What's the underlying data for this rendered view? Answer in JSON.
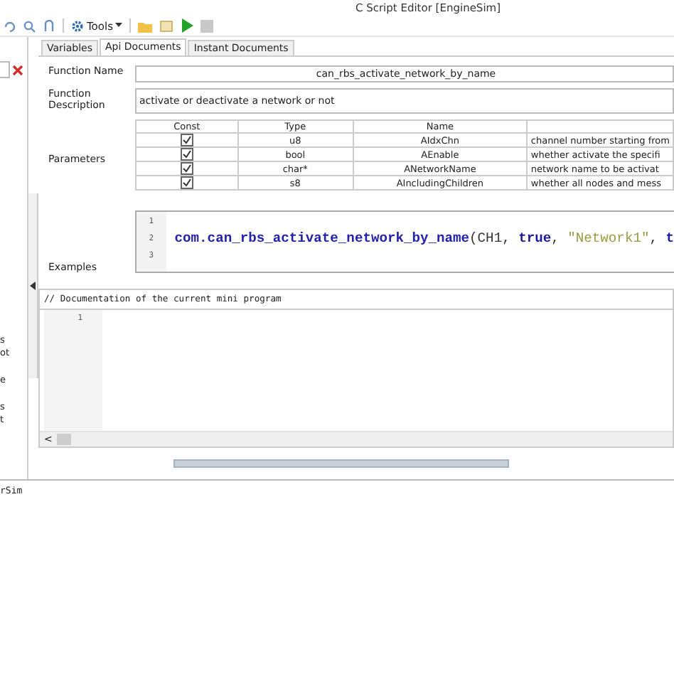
{
  "window": {
    "title": "C Script Editor [EngineSim]"
  },
  "toolbar": {
    "tools_label": "Tools"
  },
  "left_panel": {
    "fragments": [
      "s",
      "ot",
      "e",
      "s",
      "t"
    ]
  },
  "tabs": [
    {
      "label": "Variables",
      "selected": false
    },
    {
      "label": "Api Documents",
      "selected": true
    },
    {
      "label": "Instant Documents",
      "selected": false
    }
  ],
  "function_name": {
    "label": "Function Name",
    "value": "can_rbs_activate_network_by_name"
  },
  "function_description": {
    "label": "Function Description",
    "value": "activate or deactivate a network or not"
  },
  "parameters": {
    "label": "Parameters",
    "columns": [
      "Const",
      "Type",
      "Name"
    ],
    "rows": [
      {
        "const": true,
        "type": "u8",
        "name": "AIdxChn",
        "description": "channel number starting from"
      },
      {
        "const": true,
        "type": "bool",
        "name": "AEnable",
        "description": "whether activate the specifi"
      },
      {
        "const": true,
        "type": "char*",
        "name": "ANetworkName",
        "description": "network name to be activat"
      },
      {
        "const": true,
        "type": "s8",
        "name": "AIncludingChildren",
        "description": "whether all nodes and mess"
      }
    ]
  },
  "examples": {
    "label": "Examples",
    "line_numbers": [
      "1",
      "2",
      "3"
    ],
    "code_tokens": [
      {
        "kind": "func",
        "text": "com.can_rbs_activate_network_by_name"
      },
      {
        "kind": "plain",
        "text": "(CH1, "
      },
      {
        "kind": "keyword",
        "text": "true"
      },
      {
        "kind": "plain",
        "text": ", "
      },
      {
        "kind": "string",
        "text": "\"Network1\""
      },
      {
        "kind": "plain",
        "text": ", "
      },
      {
        "kind": "keyword",
        "text": "t"
      }
    ]
  },
  "documentation": {
    "header": "// Documentation of the current mini program",
    "line_numbers": [
      "1"
    ],
    "scroll_left": "<"
  },
  "output": {
    "text": "rSim"
  }
}
